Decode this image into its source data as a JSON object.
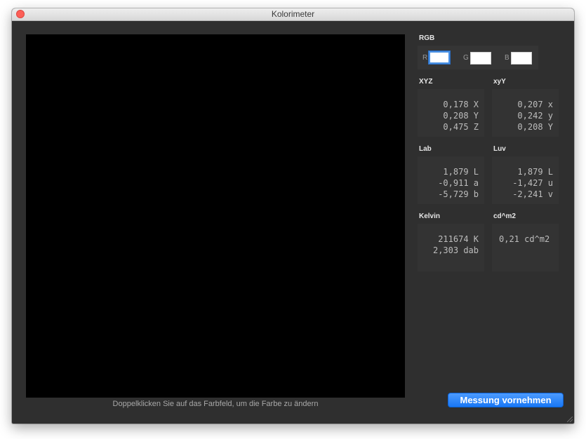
{
  "window": {
    "title": "Kolorimeter"
  },
  "swatch": {
    "color": "#000000",
    "hint": "Doppelklicken Sie auf das Farbfeld, um die Farbe zu ändern"
  },
  "rgb": {
    "label": "RGB",
    "r_label": "R",
    "g_label": "G",
    "b_label": "B",
    "r_value": "",
    "g_value": "",
    "b_value": ""
  },
  "xyz": {
    "label": "XYZ",
    "rows": [
      "0,178 X",
      "0,208 Y",
      "0,475 Z"
    ]
  },
  "xyY": {
    "label": "xyY",
    "rows": [
      "0,207 x",
      "0,242 y",
      "0,208 Y"
    ]
  },
  "lab": {
    "label": "Lab",
    "rows": [
      "1,879 L",
      "-0,911 a",
      "-5,729 b"
    ]
  },
  "luv": {
    "label": "Luv",
    "rows": [
      "1,879 L",
      "-1,427 u",
      "-2,241 v"
    ]
  },
  "kelvin": {
    "label": "Kelvin",
    "rows": [
      "211674 K",
      "2,303 dab"
    ]
  },
  "luminance": {
    "label": "cd^m2",
    "rows": [
      "0,21 cd^m2"
    ]
  },
  "actions": {
    "measure_label": "Messung vornehmen"
  },
  "colors": {
    "accent": "#1978f5",
    "close": "#fc5f57",
    "background": "#2f2f2f"
  }
}
